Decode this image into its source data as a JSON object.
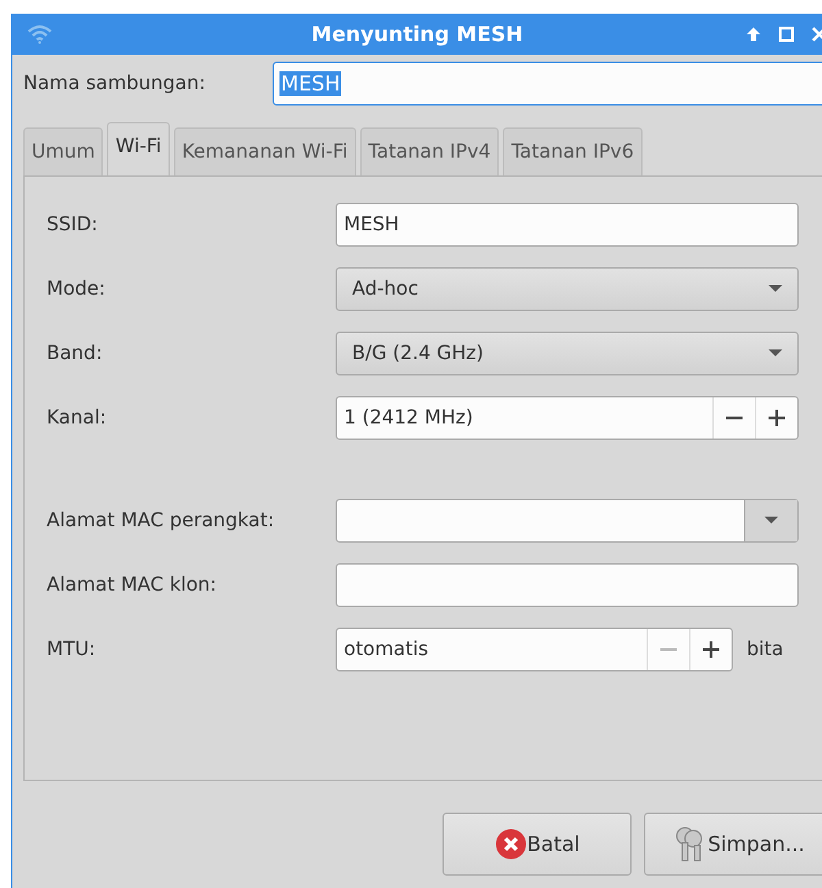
{
  "window": {
    "title": "Menyunting MESH"
  },
  "connection_name": {
    "label": "Nama sambungan:",
    "value": "MESH"
  },
  "tabs": [
    {
      "label": "Umum",
      "selected": false
    },
    {
      "label": "Wi-Fi",
      "selected": true
    },
    {
      "label": "Kemananan Wi-Fi",
      "selected": false
    },
    {
      "label": "Tatanan IPv4",
      "selected": false
    },
    {
      "label": "Tatanan IPv6",
      "selected": false
    }
  ],
  "fields": [
    {
      "kind": "entry",
      "label": "SSID:",
      "value": "MESH"
    },
    {
      "kind": "combo",
      "label": "Mode:",
      "value": "Ad-hoc"
    },
    {
      "kind": "combo",
      "label": "Band:",
      "value": "B/G (2.4 GHz)"
    },
    {
      "kind": "spin",
      "label": "Kanal:",
      "value": "1 (2412 MHz)",
      "minus_disabled": false
    },
    {
      "kind": "spacer"
    },
    {
      "kind": "combo-entry",
      "label": "Alamat MAC perangkat:"
    },
    {
      "kind": "entry",
      "label": "Alamat MAC klon:"
    },
    {
      "kind": "spin",
      "label": "MTU:",
      "value": "otomatis",
      "minus_disabled": true,
      "unit": "bita"
    }
  ],
  "buttons": [
    {
      "kind": "cancel",
      "label": "Batal"
    },
    {
      "kind": "save",
      "label": "Simpan..."
    }
  ]
}
